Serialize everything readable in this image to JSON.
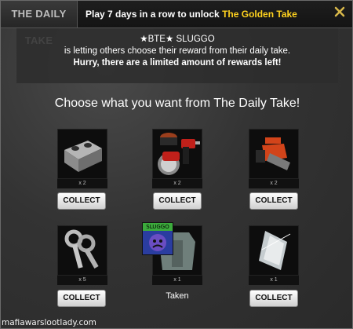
{
  "header": {
    "brand": "THE DAILY TAKE",
    "promo_prefix": "Play 7 days in a row to unlock ",
    "promo_highlight": "The Golden Take",
    "close_icon": "close-x-icon"
  },
  "notice": {
    "user": "★BTE★ SLUGGO",
    "line2": "is letting others choose their reward from their daily take.",
    "line3": "Hurry, there are a limited amount of rewards left!"
  },
  "prompt": "Choose what you want from The Daily Take!",
  "items": [
    {
      "name": "cinder-block",
      "qty": "x 2",
      "action": "COLLECT"
    },
    {
      "name": "power-tools",
      "qty": "x 2",
      "action": "COLLECT"
    },
    {
      "name": "chainsaw",
      "qty": "x 2",
      "action": "COLLECT"
    },
    {
      "name": "keys",
      "qty": "x 5",
      "action": "COLLECT"
    },
    {
      "name": "armor",
      "qty": "x 1",
      "action": "Taken",
      "avatar_label": "SLUGGO"
    },
    {
      "name": "glass-shard",
      "qty": "x 1",
      "action": "COLLECT"
    }
  ],
  "watermark": "mafiawarslootlady.com",
  "colors": {
    "accent": "#ffd21e",
    "background": "#333333"
  }
}
